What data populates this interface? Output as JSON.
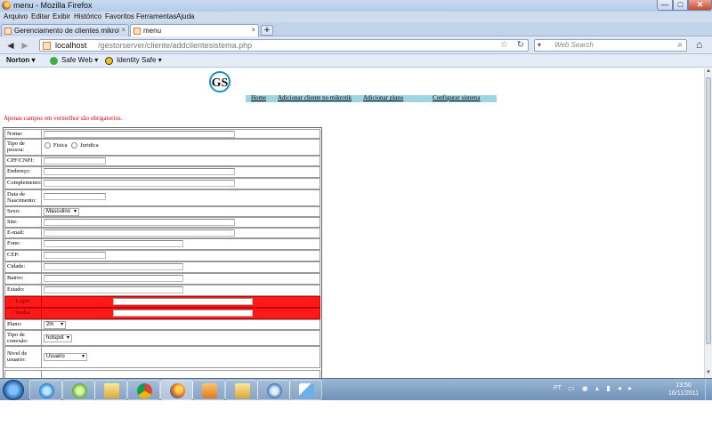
{
  "window": {
    "title": "menu - Mozilla Firefox",
    "min": "—",
    "max": "□",
    "close": "✕"
  },
  "menubar": [
    "Arquivo",
    "Editar",
    "Exibir",
    "Histórico",
    "Favoritos",
    "Ferramentas",
    "Ajuda"
  ],
  "tabs": [
    {
      "label": "Gerenciamento de clientes mikrotik g...",
      "close": "×"
    },
    {
      "label": "menu",
      "close": "×"
    }
  ],
  "new_tab": "+",
  "nav": {
    "back": "◄",
    "forward": "►",
    "url_host": "localhost",
    "url_path": "/gestorserver/cliente/addclientesistema.php",
    "star": "☆",
    "reload": "↻",
    "search_placeholder": "Web Search",
    "search_engine": "▾",
    "search_icon": "⌕",
    "home": "⌂"
  },
  "toolbar": {
    "norton": "Norton ▾",
    "safe_web": "Safe Web ▾",
    "identity_safe": "Identity Safe ▾"
  },
  "page": {
    "logo_text": "GS",
    "nav_links": [
      "Home",
      "Adicionar cliente no mikrotik",
      "Adicionar plano",
      "Configurar sistema"
    ],
    "required_note": "Apenas campos em vermelhor são obrigatorios.",
    "form": {
      "nome": "Nome:",
      "tipo_pessoa": "Tipo de pessoa:",
      "fisica": "Fisica",
      "juridica": "Juridica",
      "cpf": "CPF/CNPJ:",
      "endereco": "Endereço:",
      "complemento": "Complemento:",
      "nascimento": "Data de Nascimento:",
      "sexo": "Sexo:",
      "sexo_value": "Masculino",
      "site": "Site:",
      "email": "E-mail:",
      "fone": "Fone:",
      "cep": "CEP:",
      "cidade": "Cidade:",
      "bairro": "Bairro:",
      "estado": "Estado:",
      "login": "Login:",
      "senha": "Senha:",
      "plano": "Plano:",
      "plano_value": "2m",
      "conexao": "Tipo de conexão:",
      "conexao_value": "hotspot",
      "nivel": "Nivel de usuario:",
      "nivel_value": "Usuario"
    }
  },
  "taskbar": {
    "lang": "PT",
    "tray": "▭ ◉ ▴ ▮ ◂ ▸",
    "time": "13:50",
    "date": "16/11/2011"
  },
  "colors": {
    "required_bg": "#ff1a1a",
    "nav_strip": "#9fd4e2",
    "required_text": "#e00000"
  }
}
